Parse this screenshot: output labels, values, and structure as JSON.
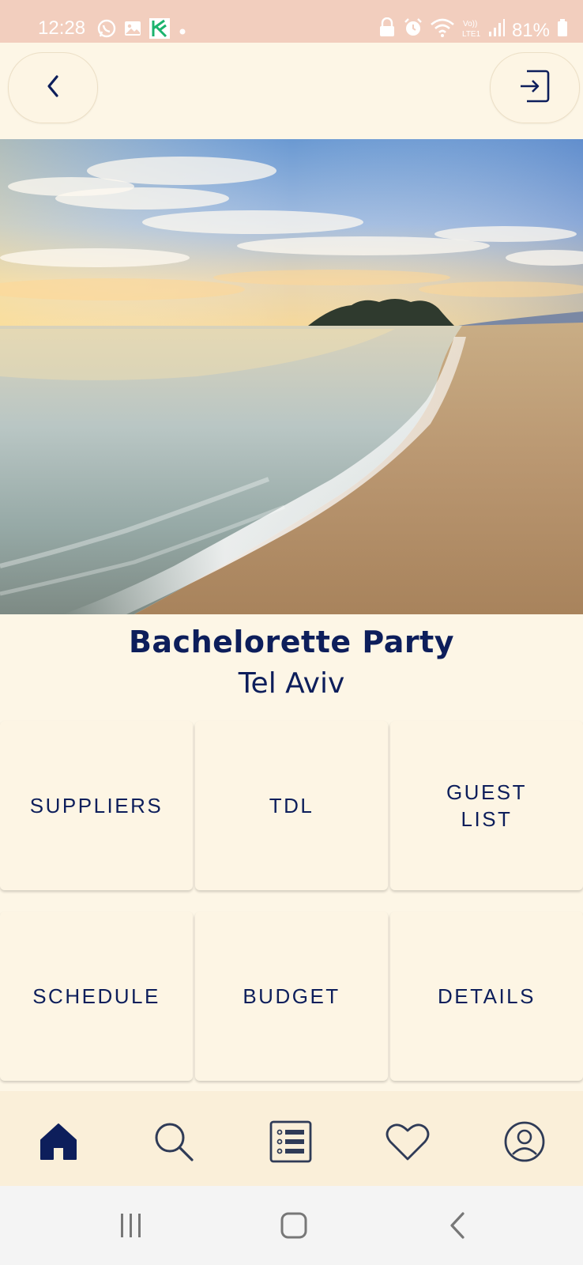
{
  "status_bar": {
    "time": "12:28",
    "battery": "81%",
    "left_icons": [
      "whatsapp-icon",
      "gallery-icon",
      "app-notification-icon",
      "dot-icon"
    ],
    "right_icons": [
      "lock-icon",
      "alarm-icon",
      "wifi-icon",
      "volte-icon",
      "signal-icon",
      "battery-icon"
    ],
    "color": "#f2cebe"
  },
  "header": {
    "back_icon": "chevron-left-icon",
    "exit_icon": "exit-icon"
  },
  "hero": {
    "image_description_icon": "beach-photo"
  },
  "event": {
    "title": "Bachelorette Party",
    "location": "Tel Aviv"
  },
  "tiles": [
    {
      "label": "SUPPLIERS"
    },
    {
      "label": "TDL"
    },
    {
      "label": "GUEST\nLIST"
    },
    {
      "label": "SCHEDULE"
    },
    {
      "label": "BUDGET"
    },
    {
      "label": "DETAILS"
    }
  ],
  "bottom_nav": {
    "items": [
      "home-icon",
      "search-icon",
      "list-icon",
      "heart-icon",
      "profile-icon"
    ],
    "active": "home-icon"
  },
  "system_nav": [
    "recents-icon",
    "home-button-icon",
    "back-icon"
  ],
  "colors": {
    "background": "#fdf6e6",
    "primary_text": "#0d1e5b",
    "status_bar": "#f2cebe",
    "bottom_nav": "#faefd9"
  }
}
